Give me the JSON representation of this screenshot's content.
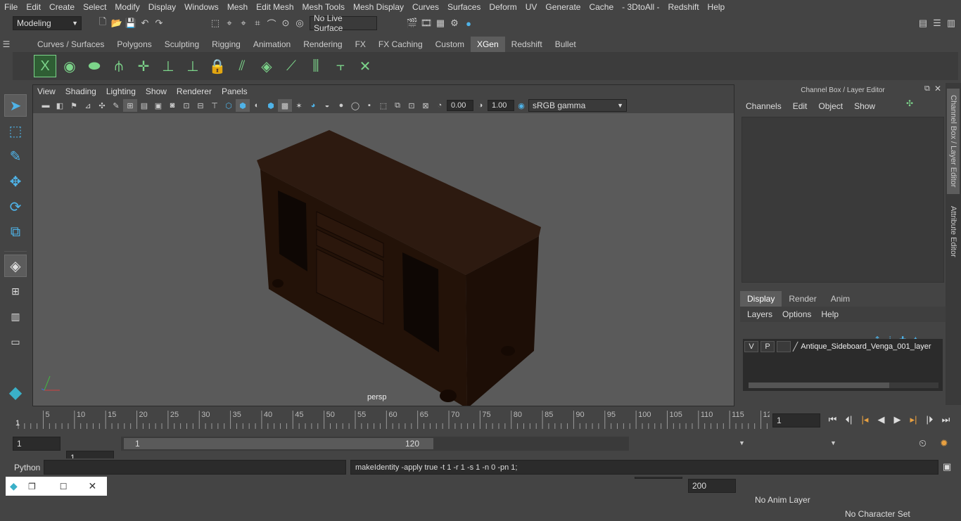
{
  "menubar": {
    "items": [
      "File",
      "Edit",
      "Create",
      "Select",
      "Modify",
      "Display",
      "Windows",
      "Mesh",
      "Edit Mesh",
      "Mesh Tools",
      "Mesh Display",
      "Curves",
      "Surfaces",
      "Deform",
      "UV",
      "Generate",
      "Cache",
      "- 3DtoAll -",
      "Redshift",
      "Help"
    ]
  },
  "statusline": {
    "mode": "Modeling",
    "live_surface": "No Live Surface"
  },
  "shelf": {
    "tabs": [
      "Curves / Surfaces",
      "Polygons",
      "Sculpting",
      "Rigging",
      "Animation",
      "Rendering",
      "FX",
      "FX Caching",
      "Custom",
      "XGen",
      "Redshift",
      "Bullet"
    ],
    "active_tab": "XGen"
  },
  "viewport": {
    "menu": [
      "View",
      "Shading",
      "Lighting",
      "Show",
      "Renderer",
      "Panels"
    ],
    "exposure": "0.00",
    "gamma": "1.00",
    "color_space": "sRGB gamma",
    "camera": "persp"
  },
  "channel_box": {
    "title": "Channel Box / Layer Editor",
    "menu": [
      "Channels",
      "Edit",
      "Object",
      "Show"
    ]
  },
  "layer_editor": {
    "tabs": [
      "Display",
      "Render",
      "Anim"
    ],
    "active_tab": "Display",
    "menu": [
      "Layers",
      "Options",
      "Help"
    ],
    "layer": {
      "v": "V",
      "p": "P",
      "name": "Antique_Sideboard_Venga_001_layer"
    }
  },
  "side_tabs": [
    "Channel Box / Layer Editor",
    "Attribute Editor"
  ],
  "timeline": {
    "ticks": [
      "5",
      "10",
      "15",
      "20",
      "25",
      "30",
      "35",
      "40",
      "45",
      "50",
      "55",
      "60",
      "65",
      "70",
      "75",
      "80",
      "85",
      "90",
      "95",
      "100",
      "105",
      "110",
      "115",
      "12"
    ],
    "start_label": "1",
    "current_frame": "1"
  },
  "range": {
    "start": "1",
    "anim_start": "1",
    "slider_start": "1",
    "slider_end": "120",
    "end": "120",
    "anim_end": "200",
    "anim_layer": "No Anim Layer",
    "character_set": "No Character Set"
  },
  "command": {
    "lang": "Python",
    "result": "makeIdentity -apply true -t 1 -r 1 -s 1 -n 0 -pn 1;"
  },
  "colors": {
    "accent": "#5d9cc9",
    "icon_green": "#7cd48a",
    "panel": "#444444"
  }
}
